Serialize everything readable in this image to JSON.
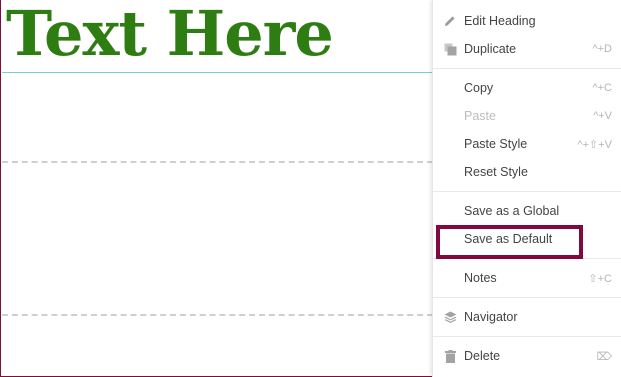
{
  "heading": {
    "text": "Text Here"
  },
  "context_menu": {
    "items": [
      {
        "label": "Edit Heading",
        "shortcut": "",
        "icon": "pencil-icon",
        "disabled": false
      },
      {
        "label": "Duplicate",
        "shortcut": "^+D",
        "icon": "duplicate-icon",
        "disabled": false
      },
      {
        "label": "Copy",
        "shortcut": "^+C",
        "icon": "",
        "disabled": false
      },
      {
        "label": "Paste",
        "shortcut": "^+V",
        "icon": "",
        "disabled": true
      },
      {
        "label": "Paste Style",
        "shortcut": "^+⇧+V",
        "icon": "",
        "disabled": false
      },
      {
        "label": "Reset Style",
        "shortcut": "",
        "icon": "",
        "disabled": false
      },
      {
        "label": "Save as a Global",
        "shortcut": "",
        "icon": "",
        "disabled": false
      },
      {
        "label": "Save as Default",
        "shortcut": "",
        "icon": "",
        "disabled": false
      },
      {
        "label": "Notes",
        "shortcut": "⇧+C",
        "icon": "",
        "disabled": false
      },
      {
        "label": "Navigator",
        "shortcut": "",
        "icon": "layers-icon",
        "disabled": false
      },
      {
        "label": "Delete",
        "shortcut": "⌦",
        "icon": "trash-icon",
        "disabled": false
      }
    ]
  },
  "colors": {
    "heading": "#2e7d12",
    "highlight": "#800a3e",
    "widget_outline": "#7ecbd6"
  }
}
